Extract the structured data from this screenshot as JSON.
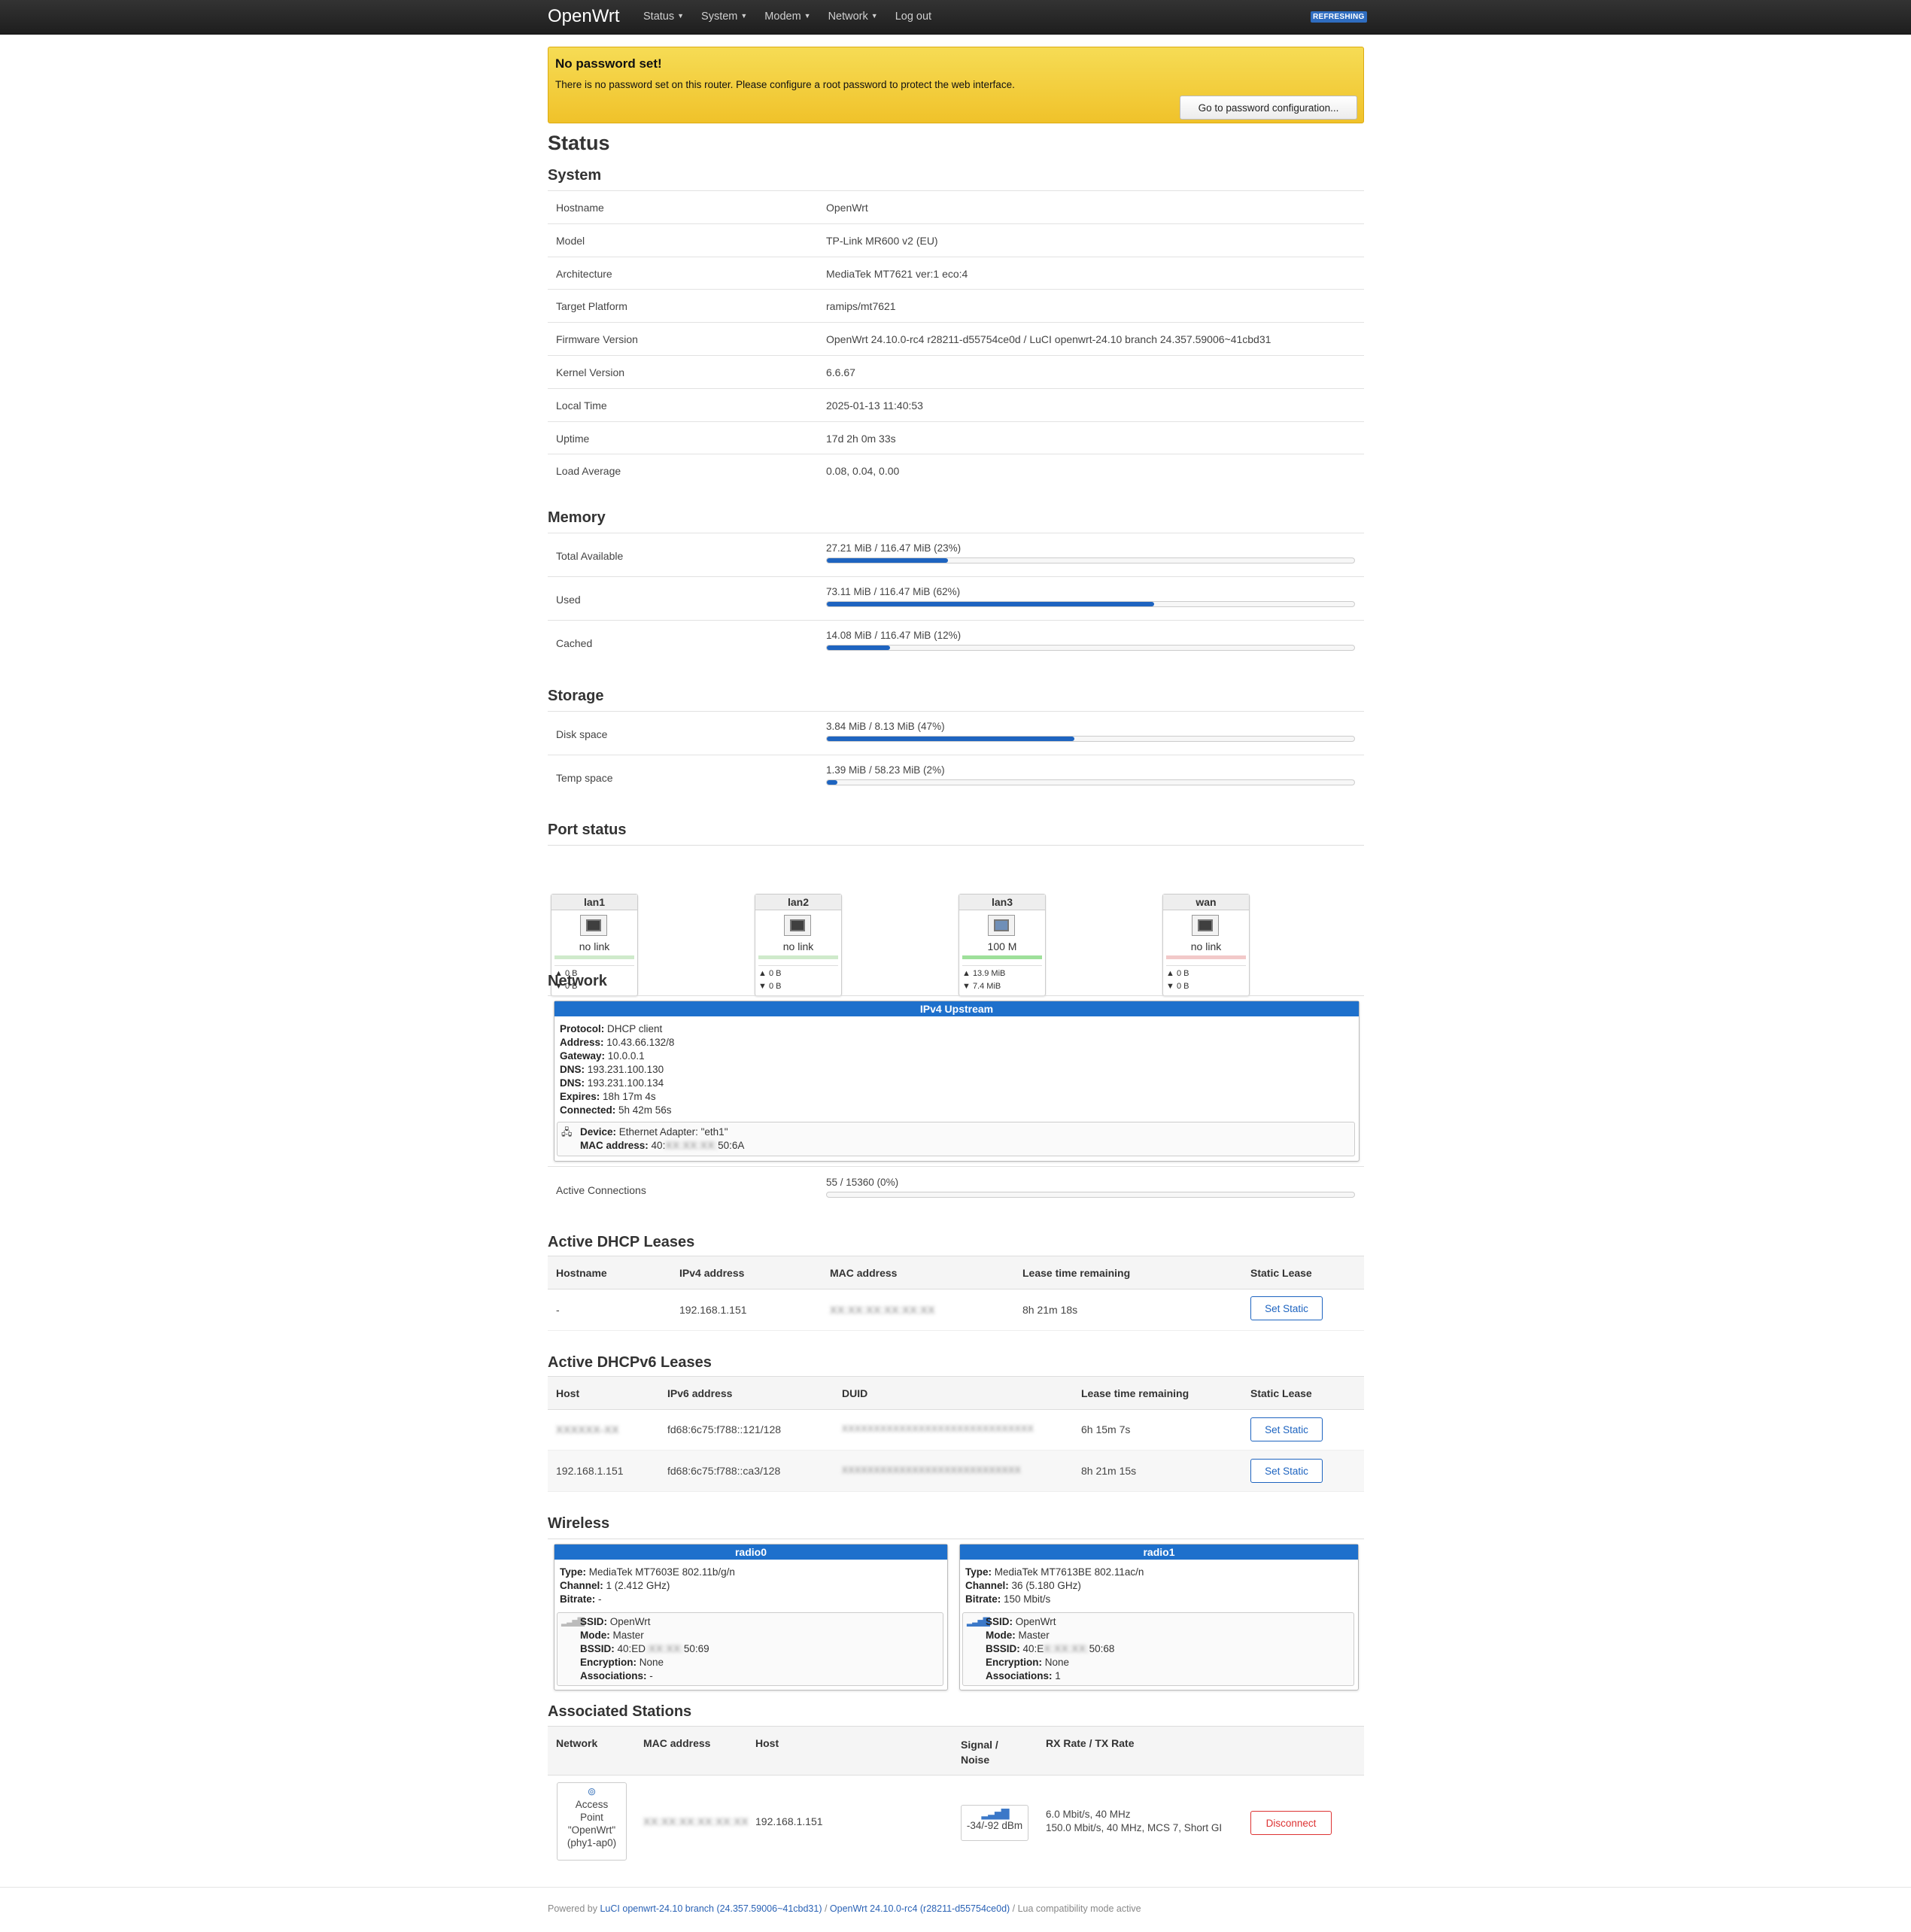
{
  "nav": {
    "brand": "OpenWrt",
    "menu": [
      "Status",
      "System",
      "Modem",
      "Network",
      "Log out"
    ],
    "refresh_badge": "REFRESHING"
  },
  "alert": {
    "title": "No password set!",
    "text": "There is no password set on this router. Please configure a root password to protect the web interface.",
    "button": "Go to password configuration..."
  },
  "page_title": "Status",
  "system": {
    "heading": "System",
    "rows": [
      {
        "label": "Hostname",
        "value": "OpenWrt"
      },
      {
        "label": "Model",
        "value": "TP-Link MR600 v2 (EU)"
      },
      {
        "label": "Architecture",
        "value": "MediaTek MT7621 ver:1 eco:4"
      },
      {
        "label": "Target Platform",
        "value": "ramips/mt7621"
      },
      {
        "label": "Firmware Version",
        "value": "OpenWrt 24.10.0-rc4 r28211-d55754ce0d / LuCI openwrt-24.10 branch 24.357.59006~41cbd31"
      },
      {
        "label": "Kernel Version",
        "value": "6.6.67"
      },
      {
        "label": "Local Time",
        "value": "2025-01-13 11:40:53"
      },
      {
        "label": "Uptime",
        "value": "17d 2h 0m 33s"
      },
      {
        "label": "Load Average",
        "value": "0.08, 0.04, 0.00"
      }
    ]
  },
  "memory": {
    "heading": "Memory",
    "rows": [
      {
        "label": "Total Available",
        "text": "27.21 MiB / 116.47 MiB (23%)",
        "percent": 23
      },
      {
        "label": "Used",
        "text": "73.11 MiB / 116.47 MiB (62%)",
        "percent": 62
      },
      {
        "label": "Cached",
        "text": "14.08 MiB / 116.47 MiB (12%)",
        "percent": 12
      }
    ]
  },
  "storage": {
    "heading": "Storage",
    "rows": [
      {
        "label": "Disk space",
        "text": "3.84 MiB / 8.13 MiB (47%)",
        "percent": 47
      },
      {
        "label": "Temp space",
        "text": "1.39 MiB / 58.23 MiB (2%)",
        "percent": 2
      }
    ]
  },
  "ports": {
    "heading": "Port status",
    "items": [
      {
        "name": "lan1",
        "speed": "no link",
        "up": "▲ 0 B",
        "down": "▼ 0 B",
        "status": "down-lan"
      },
      {
        "name": "lan2",
        "speed": "no link",
        "up": "▲ 0 B",
        "down": "▼ 0 B",
        "status": "down-lan"
      },
      {
        "name": "lan3",
        "speed": "100 M",
        "up": "▲ 13.9 MiB",
        "down": "▼ 7.4 MiB",
        "status": "up"
      },
      {
        "name": "wan",
        "speed": "no link",
        "up": "▲ 0 B",
        "down": "▼ 0 B",
        "status": "down-wan"
      }
    ]
  },
  "network": {
    "heading": "Network",
    "upstream_title": "IPv4 Upstream",
    "upstream": [
      {
        "k": "Protocol:",
        "v": "DHCP client"
      },
      {
        "k": "Address:",
        "v": "10.43.66.132/8"
      },
      {
        "k": "Gateway:",
        "v": "10.0.0.1"
      },
      {
        "k": "DNS:",
        "v": "193.231.100.130"
      },
      {
        "k": "DNS:",
        "v": "193.231.100.134"
      },
      {
        "k": "Expires:",
        "v": "18h 17m 4s"
      },
      {
        "k": "Connected:",
        "v": "5h 42m 56s"
      }
    ],
    "device_label": "Device:",
    "device": "Ethernet Adapter: \"eth1\"",
    "mac_label": "MAC address:",
    "mac_prefix": "40:",
    "mac_hidden": "XX:XX:XX:",
    "mac_suffix": "50:6A",
    "active_connections_label": "Active Connections",
    "active_connections_text": "55 / 15360 (0%)",
    "active_connections_percent": 0
  },
  "dhcp": {
    "heading": "Active DHCP Leases",
    "columns": [
      "Hostname",
      "IPv4 address",
      "MAC address",
      "Lease time remaining",
      "Static Lease"
    ],
    "rows": [
      {
        "hostname": "-",
        "ip": "192.168.1.151",
        "mac": "XX:XX:XX:XX:XX:XX",
        "remaining": "8h 21m 18s",
        "action": "Set Static"
      }
    ]
  },
  "dhcpv6": {
    "heading": "Active DHCPv6 Leases",
    "columns": [
      "Host",
      "IPv6 address",
      "DUID",
      "Lease time remaining",
      "Static Lease"
    ],
    "rows": [
      {
        "host": "XXXXXX-XX",
        "ip": "fd68:6c75:f788::121/128",
        "duid": "XXXXXXXXXXXXXXXXXXXXXXXXXXXXXX",
        "remaining": "6h 15m 7s",
        "action": "Set Static"
      },
      {
        "host": "192.168.1.151",
        "ip": "fd68:6c75:f788::ca3/128",
        "duid": "XXXXXXXXXXXXXXXXXXXXXXXXXXXX",
        "remaining": "8h 21m 15s",
        "action": "Set Static"
      }
    ]
  },
  "wireless": {
    "heading": "Wireless",
    "radios": [
      {
        "title": "radio0",
        "type": "MediaTek MT7603E 802.11b/g/n",
        "channel": "1 (2.412 GHz)",
        "bitrate": "-",
        "ssid": "OpenWrt",
        "mode": "Master",
        "bssid_prefix": "40:ED",
        "bssid_hidden": ":XX:XX:",
        "bssid_suffix": "50:69",
        "encryption": "None",
        "associations": "-"
      },
      {
        "title": "radio1",
        "type": "MediaTek MT7613BE 802.11ac/n",
        "channel": "36 (5.180 GHz)",
        "bitrate": "150 Mbit/s",
        "ssid": "OpenWrt",
        "mode": "Master",
        "bssid_prefix": "40:E",
        "bssid_hidden": "X:XX:XX:",
        "bssid_suffix": "50:68",
        "encryption": "None",
        "associations": "1"
      }
    ],
    "labels": {
      "type": "Type:",
      "channel": "Channel:",
      "bitrate": "Bitrate:",
      "ssid": "SSID:",
      "mode": "Mode:",
      "bssid": "BSSID:",
      "encryption": "Encryption:",
      "associations": "Associations:"
    }
  },
  "stations": {
    "heading": "Associated Stations",
    "columns": [
      "Network",
      "MAC address",
      "Host",
      "Signal /",
      "Noise",
      "RX Rate / TX Rate"
    ],
    "rows": [
      {
        "network_lines": [
          "Access",
          "Point",
          "\"OpenWrt\"",
          "(phy1-ap0)"
        ],
        "mac": "XX:XX:XX:XX:XX:XX",
        "host": "192.168.1.151",
        "signal": "-34/-92 dBm",
        "rx": "6.0 Mbit/s, 40 MHz",
        "tx": "150.0 Mbit/s, 40 MHz, MCS 7, Short GI",
        "action": "Disconnect"
      }
    ]
  },
  "footer": {
    "powered": "Powered by ",
    "luci_link": "LuCI openwrt-24.10 branch (24.357.59006~41cbd31)",
    "sep": " / ",
    "openwrt_link": "OpenWrt 24.10.0-rc4 (r28211-d55754ce0d)",
    "tail": " / Lua compatibility mode active"
  },
  "colors": {
    "accent": "#1e70cc",
    "bar": "#1e64c0",
    "alert": "#f0c22a",
    "link_up": "#9ee09a",
    "link_down_wan": "#f2c9c9",
    "link_down_lan": "#cfeacb"
  }
}
